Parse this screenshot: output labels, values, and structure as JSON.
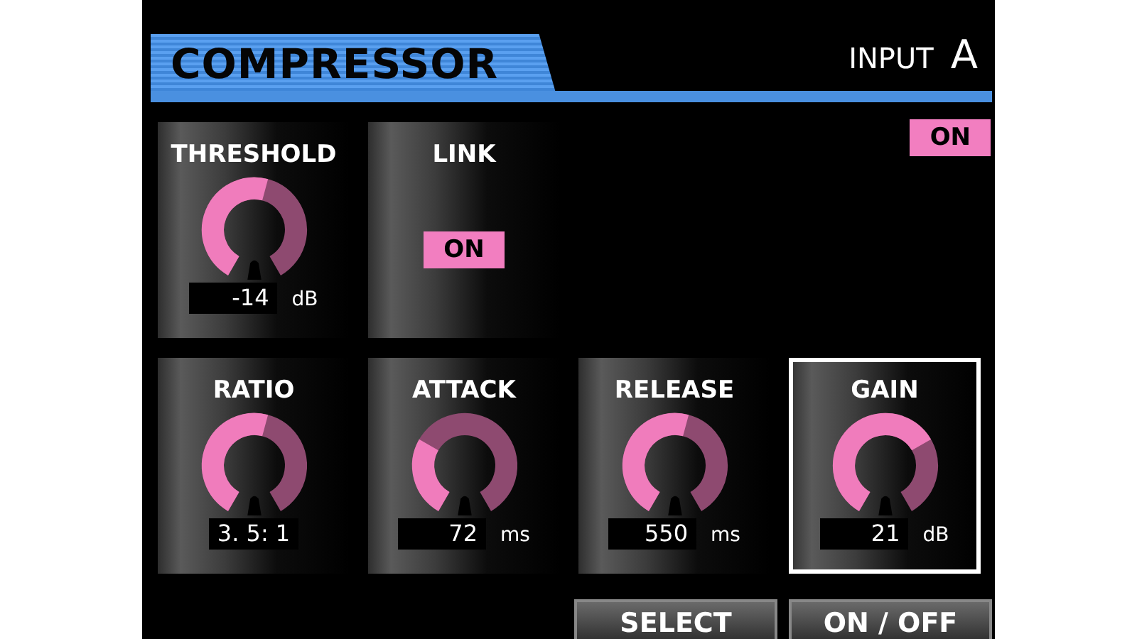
{
  "header": {
    "title": "COMPRESSOR",
    "input_label": "INPUT",
    "input_value": "A"
  },
  "power": {
    "label": "ON",
    "on": true
  },
  "rows": [
    [
      {
        "kind": "knob",
        "label": "THRESHOLD",
        "value": "-14",
        "unit": "dB",
        "selected": false
      },
      {
        "kind": "toggle",
        "label": "LINK",
        "state_label": "ON",
        "on": true,
        "selected": false
      }
    ],
    [
      {
        "kind": "knob",
        "label": "RATIO",
        "value": "3. 5: 1",
        "selected": false
      },
      {
        "kind": "knob",
        "label": "ATTACK",
        "value": "72",
        "unit": "ms",
        "selected": false
      },
      {
        "kind": "knob",
        "label": "RELEASE",
        "value": "550",
        "unit": "ms",
        "selected": false
      },
      {
        "kind": "knob",
        "label": "GAIN",
        "value": "21",
        "unit": "dB",
        "selected": true
      }
    ]
  ],
  "buttons": [
    "SELECT",
    "ON / OFF"
  ]
}
